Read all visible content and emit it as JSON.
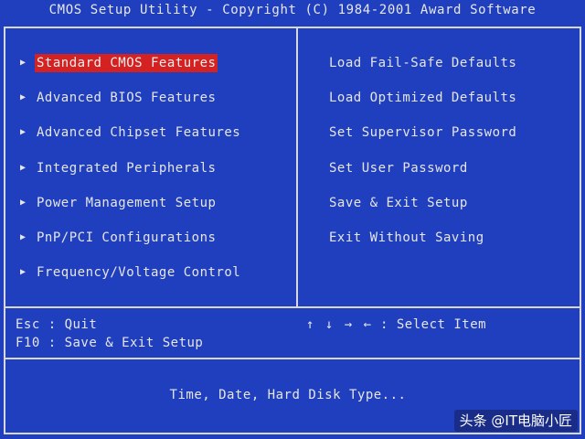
{
  "title": "CMOS Setup Utility - Copyright (C) 1984-2001 Award Software",
  "left_menu": [
    {
      "label": "Standard CMOS Features",
      "selected": true
    },
    {
      "label": "Advanced BIOS Features",
      "selected": false
    },
    {
      "label": "Advanced Chipset Features",
      "selected": false
    },
    {
      "label": "Integrated Peripherals",
      "selected": false
    },
    {
      "label": "Power Management Setup",
      "selected": false
    },
    {
      "label": "PnP/PCI Configurations",
      "selected": false
    },
    {
      "label": "Frequency/Voltage Control",
      "selected": false
    }
  ],
  "right_menu": [
    {
      "label": "Load Fail-Safe Defaults"
    },
    {
      "label": "Load Optimized Defaults"
    },
    {
      "label": "Set Supervisor Password"
    },
    {
      "label": "Set User Password"
    },
    {
      "label": "Save & Exit Setup"
    },
    {
      "label": "Exit Without Saving"
    }
  ],
  "help": {
    "esc": "Esc : Quit",
    "f10": "F10 : Save & Exit Setup",
    "arrows": "↑ ↓ → ←",
    "select": ": Select Item"
  },
  "status": {
    "description": "Time, Date, Hard Disk Type..."
  },
  "watermark": {
    "text": "头条 @IT电脑小匠"
  },
  "colors": {
    "background": "#1f3fbf",
    "text": "#e6e6e6",
    "highlight": "#d42222",
    "border": "#d8d8d8"
  },
  "icons": {
    "menu_marker": "triangle-right-icon"
  }
}
